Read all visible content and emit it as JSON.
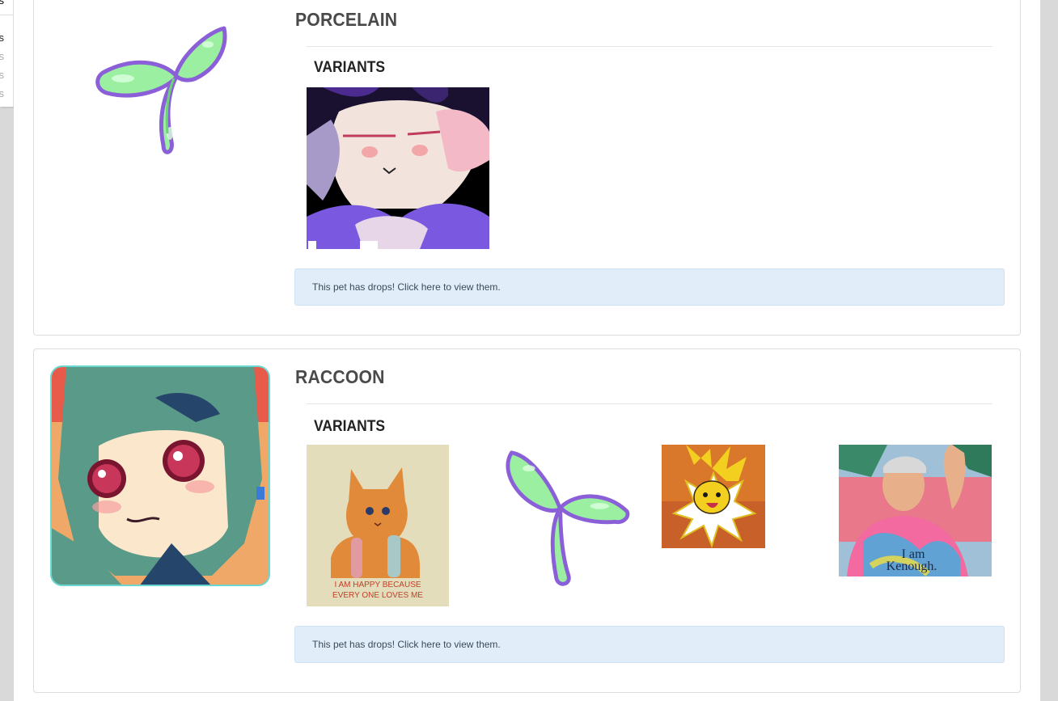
{
  "side_menu": {
    "items": [
      {
        "label": "s",
        "color": "#333333"
      },
      {
        "label": "s",
        "color": "#222222"
      },
      {
        "label": "s",
        "color": "#aaaaaa"
      },
      {
        "label": "s",
        "color": "#aaaaaa"
      },
      {
        "label": "s",
        "color": "#aaaaaa"
      }
    ]
  },
  "pets": [
    {
      "name": "PORCELAIN",
      "image": "sprout-icon",
      "variants_heading": "VARIANTS",
      "variants": [
        "anthro-portrait-image"
      ],
      "drops_text": "This pet has drops! Click here to view them."
    },
    {
      "name": "RACCOON",
      "image": "green-haired-character-portrait",
      "variants_heading": "VARIANTS",
      "variants": [
        "orange-kitten-painting",
        "sprout-icon",
        "jolteon-image",
        "man-tiedye-hoodie-photo"
      ],
      "variant_texts": {
        "kitten_caption_line1": "I AM HAPPY BECAUSE",
        "kitten_caption_line2": "EVERY ONE LOVES ME",
        "hoodie_line1": "I am",
        "hoodie_line2": "Kenough."
      },
      "drops_text": "This pet has drops! Click here to view them."
    }
  ],
  "colors": {
    "page_bg": "#d9d9d9",
    "card_border": "#dddddd",
    "alert_bg": "#e1eef9",
    "heading": "#4a4a4a"
  }
}
